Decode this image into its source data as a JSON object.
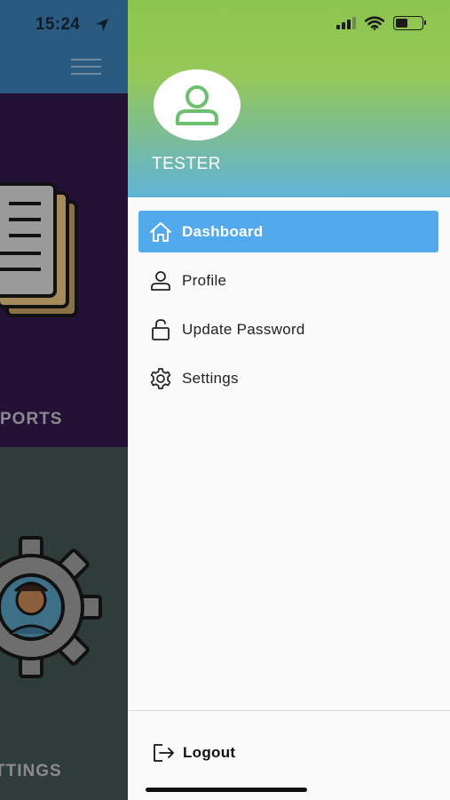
{
  "status_bar": {
    "time": "15:24"
  },
  "background": {
    "card1_label": "PORTS",
    "card2_label": "TTINGS"
  },
  "drawer": {
    "username": "TESTER",
    "menu": [
      {
        "label": "Dashboard",
        "icon": "home-icon",
        "active": true
      },
      {
        "label": "Profile",
        "icon": "user-icon",
        "active": false
      },
      {
        "label": "Update Password",
        "icon": "unlock-icon",
        "active": false
      },
      {
        "label": "Settings",
        "icon": "gear-icon",
        "active": false
      }
    ],
    "logout_label": "Logout"
  },
  "colors": {
    "active_item": "#52aaec",
    "header_top": "#8cc54f",
    "header_bottom": "#5fb3d8",
    "avatar_icon": "#6cbf6c"
  }
}
